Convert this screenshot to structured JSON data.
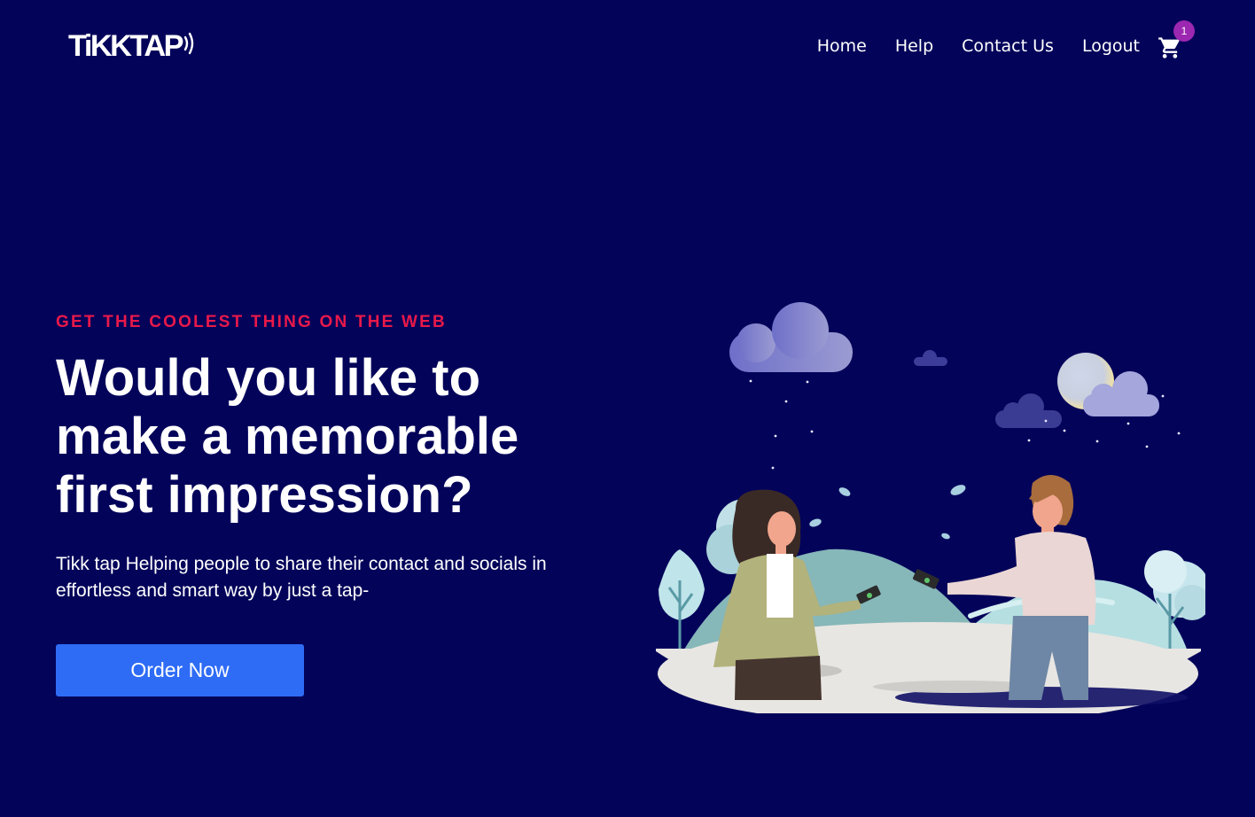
{
  "brand": {
    "logo_text": "TiKKTAP"
  },
  "nav": {
    "items": [
      {
        "label": "Home"
      },
      {
        "label": "Help"
      },
      {
        "label": "Contact Us"
      },
      {
        "label": "Logout"
      }
    ],
    "cart_count": "1"
  },
  "hero": {
    "eyebrow": "GET THE COOLEST THING ON THE WEB",
    "headline": "Would you like to make a memorable first impression?",
    "description": "Tikk tap Helping people to share their contact and socials in effortless and smart way by just a tap-",
    "cta_label": "Order Now"
  },
  "colors": {
    "background": "#03035a",
    "accent": "#e8194a",
    "button": "#2e6cf6",
    "badge": "#9c27b0"
  },
  "icons": [
    "cart-icon",
    "contactless-icon"
  ]
}
